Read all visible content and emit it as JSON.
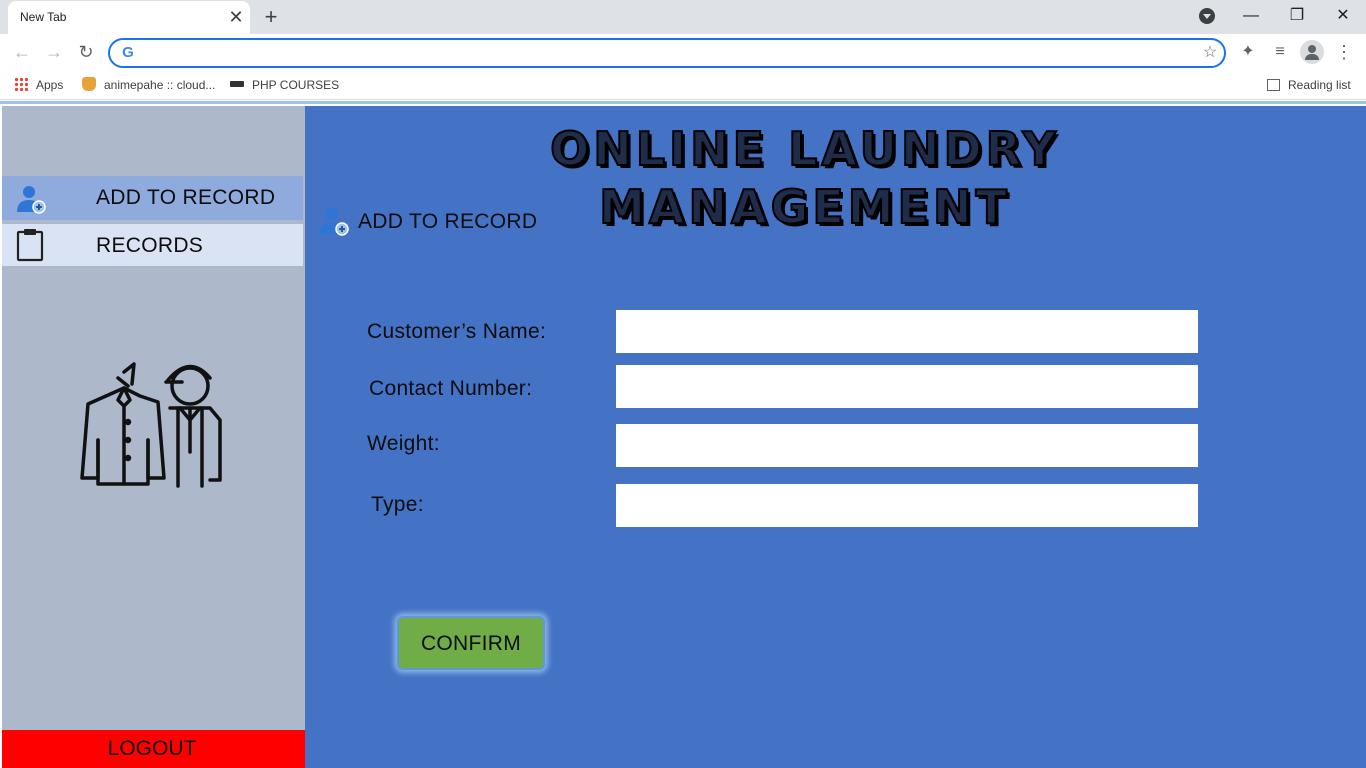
{
  "browser": {
    "tab_title": "New Tab",
    "tab_close_glyph": "✕",
    "new_tab_glyph": "+",
    "address_value": "",
    "window_controls": {
      "minimize": "—",
      "restore": "❐",
      "close": "✕"
    },
    "bookmarks": [
      {
        "label": "Apps",
        "icon": "apps-grid-icon"
      },
      {
        "label": "animepahe :: cloud...",
        "icon": "cat-favicon-icon"
      },
      {
        "label": "PHP COURSES",
        "icon": "php-favicon-icon"
      }
    ],
    "reading_list_label": "Reading list"
  },
  "sidebar": {
    "items": [
      {
        "label": "ADD TO RECORD",
        "icon": "add-user-icon",
        "active": true
      },
      {
        "label": "RECORDS",
        "icon": "clipboard-icon",
        "active": false
      }
    ],
    "illustration": "laundry-worker-icon",
    "logout_label": "LOGOUT"
  },
  "main": {
    "title": "ONLINE LAUNDRY MANAGEMENT",
    "section_title": "ADD TO RECORD",
    "form": {
      "name_label": "Customer’s Name:",
      "name_value": "",
      "contact_label": "Contact Number:",
      "contact_value": "",
      "weight_label": "Weight:",
      "weight_value": "",
      "type_label": "Type:",
      "type_value": ""
    },
    "confirm_label": "CONFIRM"
  },
  "colors": {
    "main_bg": "#4472c4",
    "sidebar_bg": "#adb9ca",
    "active_item_bg": "#8faadc",
    "records_item_bg": "#dae3f3",
    "logout_bg": "#ff0000",
    "confirm_bg": "#70ad47"
  }
}
